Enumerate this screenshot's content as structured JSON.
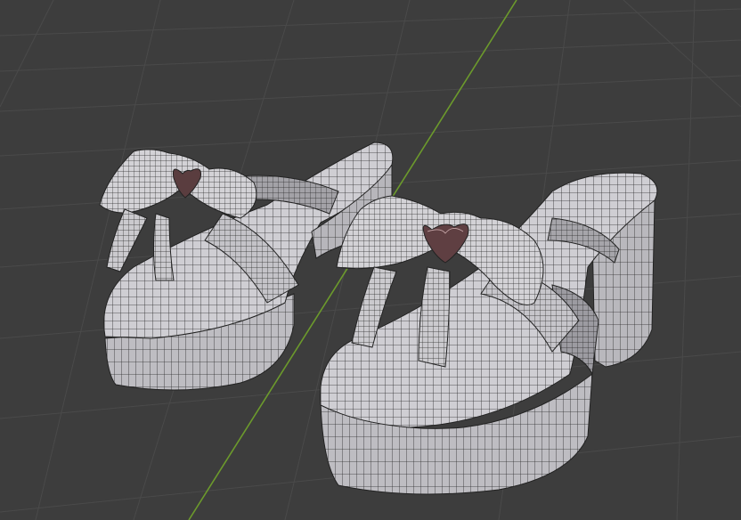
{
  "viewport": {
    "background": "#3d3d3d",
    "grid_color": "#4a4a4a",
    "y_axis_color": "#6c9a2c",
    "mesh_face_color": "#c9c8cc",
    "mesh_shadow_color": "#9b9aa0",
    "wire_color": "#2a2a2a"
  },
  "scene": {
    "objects": [
      {
        "name": "left-sandal",
        "parts": [
          "platform-sole",
          "footbed",
          "toe-strap",
          "side-strap",
          "bow",
          "heart-charm"
        ]
      },
      {
        "name": "right-sandal",
        "parts": [
          "platform-sole",
          "heel",
          "footbed",
          "toe-strap",
          "side-strap",
          "bow",
          "heart-charm"
        ]
      }
    ],
    "shading_mode": "wireframe-overlay"
  }
}
